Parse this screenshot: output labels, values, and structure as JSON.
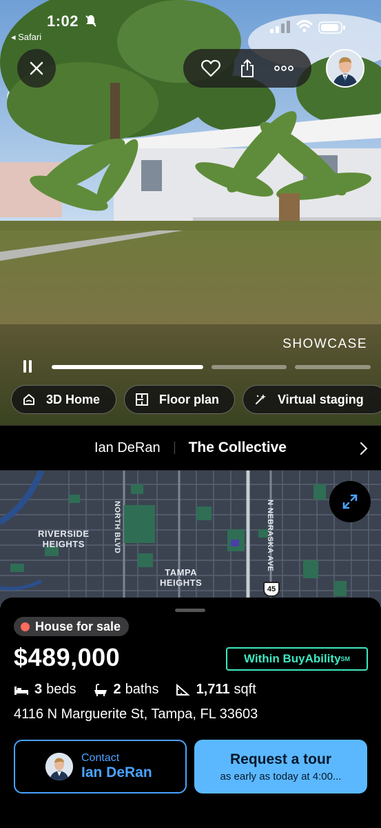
{
  "status_bar": {
    "time": "1:02",
    "back_app": "◂ Safari"
  },
  "hero": {
    "showcase_label": "SHOWCASE",
    "progress": [
      1.0,
      0.0,
      0.0
    ],
    "chips": [
      {
        "label": "3D Home",
        "icon": "3d-home-icon"
      },
      {
        "label": "Floor plan",
        "icon": "floor-plan-icon"
      },
      {
        "label": "Virtual staging",
        "icon": "magic-wand-icon"
      }
    ]
  },
  "agent_bar": {
    "agent": "Ian DeRan",
    "brokerage": "The Collective"
  },
  "map": {
    "labels": {
      "riverside_1": "RIVERSIDE",
      "riverside_2": "HEIGHTS",
      "tampa_1": "TAMPA",
      "tampa_2": "HEIGHTS",
      "north_blvd": "NORTH BLVD",
      "nebraska": "N NEBRASKA AVE",
      "route": "45"
    }
  },
  "listing": {
    "status": "House for sale",
    "price": "$489,000",
    "buyability": "Within BuyAbility",
    "buyability_mark": "SM",
    "beds": "3",
    "beds_label": "beds",
    "baths": "2",
    "baths_label": "baths",
    "sqft": "1,711",
    "sqft_label": "sqft",
    "address": "4116 N Marguerite St, Tampa, FL 33603"
  },
  "actions": {
    "contact_label": "Contact",
    "contact_name": "Ian DeRan",
    "tour_title": "Request a tour",
    "tour_sub": "as early as today at 4:00..."
  },
  "colors": {
    "accent_blue": "#4aa3ff",
    "tour_bg": "#5bb8ff",
    "buyability": "#3ee8c0",
    "status_dot": "#ff6b5b",
    "map_bg": "#3a4250"
  }
}
